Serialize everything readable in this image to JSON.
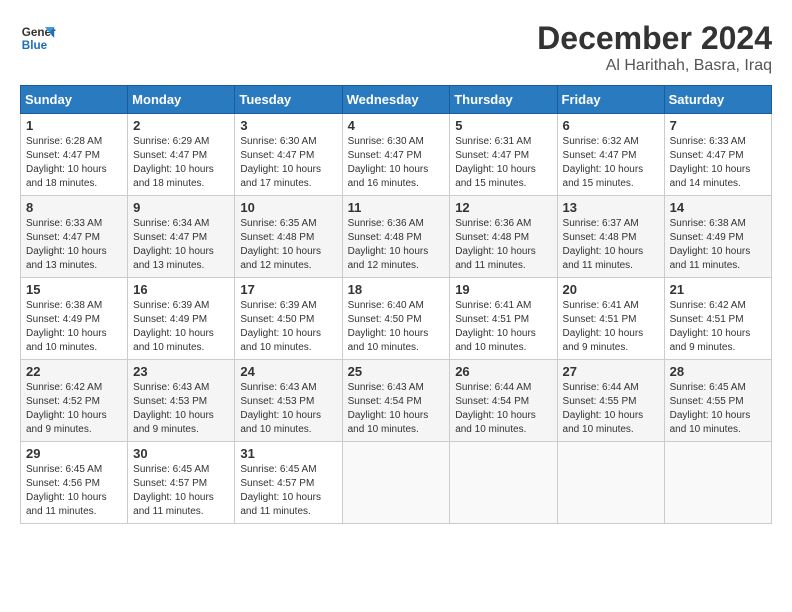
{
  "logo": {
    "line1": "General",
    "line2": "Blue"
  },
  "title": "December 2024",
  "location": "Al Harithah, Basra, Iraq",
  "headers": [
    "Sunday",
    "Monday",
    "Tuesday",
    "Wednesday",
    "Thursday",
    "Friday",
    "Saturday"
  ],
  "weeks": [
    [
      {
        "day": "1",
        "info": "Sunrise: 6:28 AM\nSunset: 4:47 PM\nDaylight: 10 hours\nand 18 minutes."
      },
      {
        "day": "2",
        "info": "Sunrise: 6:29 AM\nSunset: 4:47 PM\nDaylight: 10 hours\nand 18 minutes."
      },
      {
        "day": "3",
        "info": "Sunrise: 6:30 AM\nSunset: 4:47 PM\nDaylight: 10 hours\nand 17 minutes."
      },
      {
        "day": "4",
        "info": "Sunrise: 6:30 AM\nSunset: 4:47 PM\nDaylight: 10 hours\nand 16 minutes."
      },
      {
        "day": "5",
        "info": "Sunrise: 6:31 AM\nSunset: 4:47 PM\nDaylight: 10 hours\nand 15 minutes."
      },
      {
        "day": "6",
        "info": "Sunrise: 6:32 AM\nSunset: 4:47 PM\nDaylight: 10 hours\nand 15 minutes."
      },
      {
        "day": "7",
        "info": "Sunrise: 6:33 AM\nSunset: 4:47 PM\nDaylight: 10 hours\nand 14 minutes."
      }
    ],
    [
      {
        "day": "8",
        "info": "Sunrise: 6:33 AM\nSunset: 4:47 PM\nDaylight: 10 hours\nand 13 minutes."
      },
      {
        "day": "9",
        "info": "Sunrise: 6:34 AM\nSunset: 4:47 PM\nDaylight: 10 hours\nand 13 minutes."
      },
      {
        "day": "10",
        "info": "Sunrise: 6:35 AM\nSunset: 4:48 PM\nDaylight: 10 hours\nand 12 minutes."
      },
      {
        "day": "11",
        "info": "Sunrise: 6:36 AM\nSunset: 4:48 PM\nDaylight: 10 hours\nand 12 minutes."
      },
      {
        "day": "12",
        "info": "Sunrise: 6:36 AM\nSunset: 4:48 PM\nDaylight: 10 hours\nand 11 minutes."
      },
      {
        "day": "13",
        "info": "Sunrise: 6:37 AM\nSunset: 4:48 PM\nDaylight: 10 hours\nand 11 minutes."
      },
      {
        "day": "14",
        "info": "Sunrise: 6:38 AM\nSunset: 4:49 PM\nDaylight: 10 hours\nand 11 minutes."
      }
    ],
    [
      {
        "day": "15",
        "info": "Sunrise: 6:38 AM\nSunset: 4:49 PM\nDaylight: 10 hours\nand 10 minutes."
      },
      {
        "day": "16",
        "info": "Sunrise: 6:39 AM\nSunset: 4:49 PM\nDaylight: 10 hours\nand 10 minutes."
      },
      {
        "day": "17",
        "info": "Sunrise: 6:39 AM\nSunset: 4:50 PM\nDaylight: 10 hours\nand 10 minutes."
      },
      {
        "day": "18",
        "info": "Sunrise: 6:40 AM\nSunset: 4:50 PM\nDaylight: 10 hours\nand 10 minutes."
      },
      {
        "day": "19",
        "info": "Sunrise: 6:41 AM\nSunset: 4:51 PM\nDaylight: 10 hours\nand 10 minutes."
      },
      {
        "day": "20",
        "info": "Sunrise: 6:41 AM\nSunset: 4:51 PM\nDaylight: 10 hours\nand 9 minutes."
      },
      {
        "day": "21",
        "info": "Sunrise: 6:42 AM\nSunset: 4:51 PM\nDaylight: 10 hours\nand 9 minutes."
      }
    ],
    [
      {
        "day": "22",
        "info": "Sunrise: 6:42 AM\nSunset: 4:52 PM\nDaylight: 10 hours\nand 9 minutes."
      },
      {
        "day": "23",
        "info": "Sunrise: 6:43 AM\nSunset: 4:53 PM\nDaylight: 10 hours\nand 9 minutes."
      },
      {
        "day": "24",
        "info": "Sunrise: 6:43 AM\nSunset: 4:53 PM\nDaylight: 10 hours\nand 10 minutes."
      },
      {
        "day": "25",
        "info": "Sunrise: 6:43 AM\nSunset: 4:54 PM\nDaylight: 10 hours\nand 10 minutes."
      },
      {
        "day": "26",
        "info": "Sunrise: 6:44 AM\nSunset: 4:54 PM\nDaylight: 10 hours\nand 10 minutes."
      },
      {
        "day": "27",
        "info": "Sunrise: 6:44 AM\nSunset: 4:55 PM\nDaylight: 10 hours\nand 10 minutes."
      },
      {
        "day": "28",
        "info": "Sunrise: 6:45 AM\nSunset: 4:55 PM\nDaylight: 10 hours\nand 10 minutes."
      }
    ],
    [
      {
        "day": "29",
        "info": "Sunrise: 6:45 AM\nSunset: 4:56 PM\nDaylight: 10 hours\nand 11 minutes."
      },
      {
        "day": "30",
        "info": "Sunrise: 6:45 AM\nSunset: 4:57 PM\nDaylight: 10 hours\nand 11 minutes."
      },
      {
        "day": "31",
        "info": "Sunrise: 6:45 AM\nSunset: 4:57 PM\nDaylight: 10 hours\nand 11 minutes."
      },
      {
        "day": "",
        "info": ""
      },
      {
        "day": "",
        "info": ""
      },
      {
        "day": "",
        "info": ""
      },
      {
        "day": "",
        "info": ""
      }
    ]
  ]
}
